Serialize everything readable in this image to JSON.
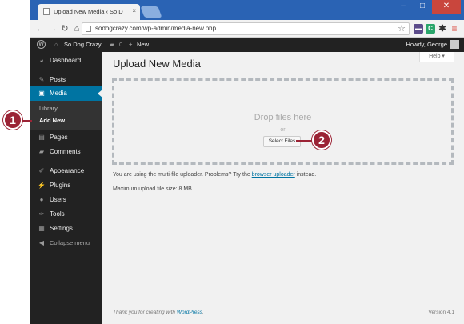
{
  "browser": {
    "tab_title": "Upload New Media ‹ So D",
    "tab_close": "×",
    "url": "sodogcrazy.com/wp-admin/media-new.php",
    "window_controls": {
      "minimize": "–",
      "maximize": "□",
      "close": "✕"
    },
    "extensions": [
      {
        "name": "bookmark-ext-icon",
        "color": "#5b4b8a",
        "glyph": "▬"
      },
      {
        "name": "c-ext-icon",
        "color": "#2aa56b",
        "glyph": "C"
      },
      {
        "name": "gear-ext-icon",
        "color": "#333333",
        "glyph": "✱"
      },
      {
        "name": "menu-icon",
        "color": "#d9473c",
        "glyph": "≡"
      }
    ]
  },
  "adminbar": {
    "site_name": "So Dog Crazy",
    "comments_count": "0",
    "new_label": "New",
    "greeting": "Howdy, George"
  },
  "sidebar": {
    "items": [
      {
        "label": "Dashboard",
        "icon": "dashboard-icon"
      },
      {
        "label": "Posts",
        "icon": "pin-icon"
      },
      {
        "label": "Media",
        "icon": "media-icon"
      },
      {
        "label": "Pages",
        "icon": "pages-icon"
      },
      {
        "label": "Comments",
        "icon": "comments-icon"
      },
      {
        "label": "Appearance",
        "icon": "brush-icon"
      },
      {
        "label": "Plugins",
        "icon": "plug-icon"
      },
      {
        "label": "Users",
        "icon": "users-icon"
      },
      {
        "label": "Tools",
        "icon": "wrench-icon"
      },
      {
        "label": "Settings",
        "icon": "settings-icon"
      },
      {
        "label": "Collapse menu",
        "icon": "collapse-icon"
      }
    ],
    "submenu": [
      "Library",
      "Add New"
    ]
  },
  "main": {
    "title": "Upload New Media",
    "help": "Help ▾",
    "drop_text": "Drop files here",
    "or_text": "or",
    "select_button": "Select Files",
    "note_before": "You are using the multi-file uploader. Problems? Try the ",
    "note_link": "browser uploader",
    "note_after": " instead.",
    "max_size": "Maximum upload file size: 8 MB.",
    "footer_before": "Thank you for creating with ",
    "footer_link": "WordPress",
    "footer_after": ".",
    "version": "Version 4.1"
  },
  "callouts": {
    "one": "1",
    "two": "2"
  },
  "colors": {
    "accent": "#0074a2",
    "callout": "#9b2335",
    "adminbar": "#222222"
  }
}
